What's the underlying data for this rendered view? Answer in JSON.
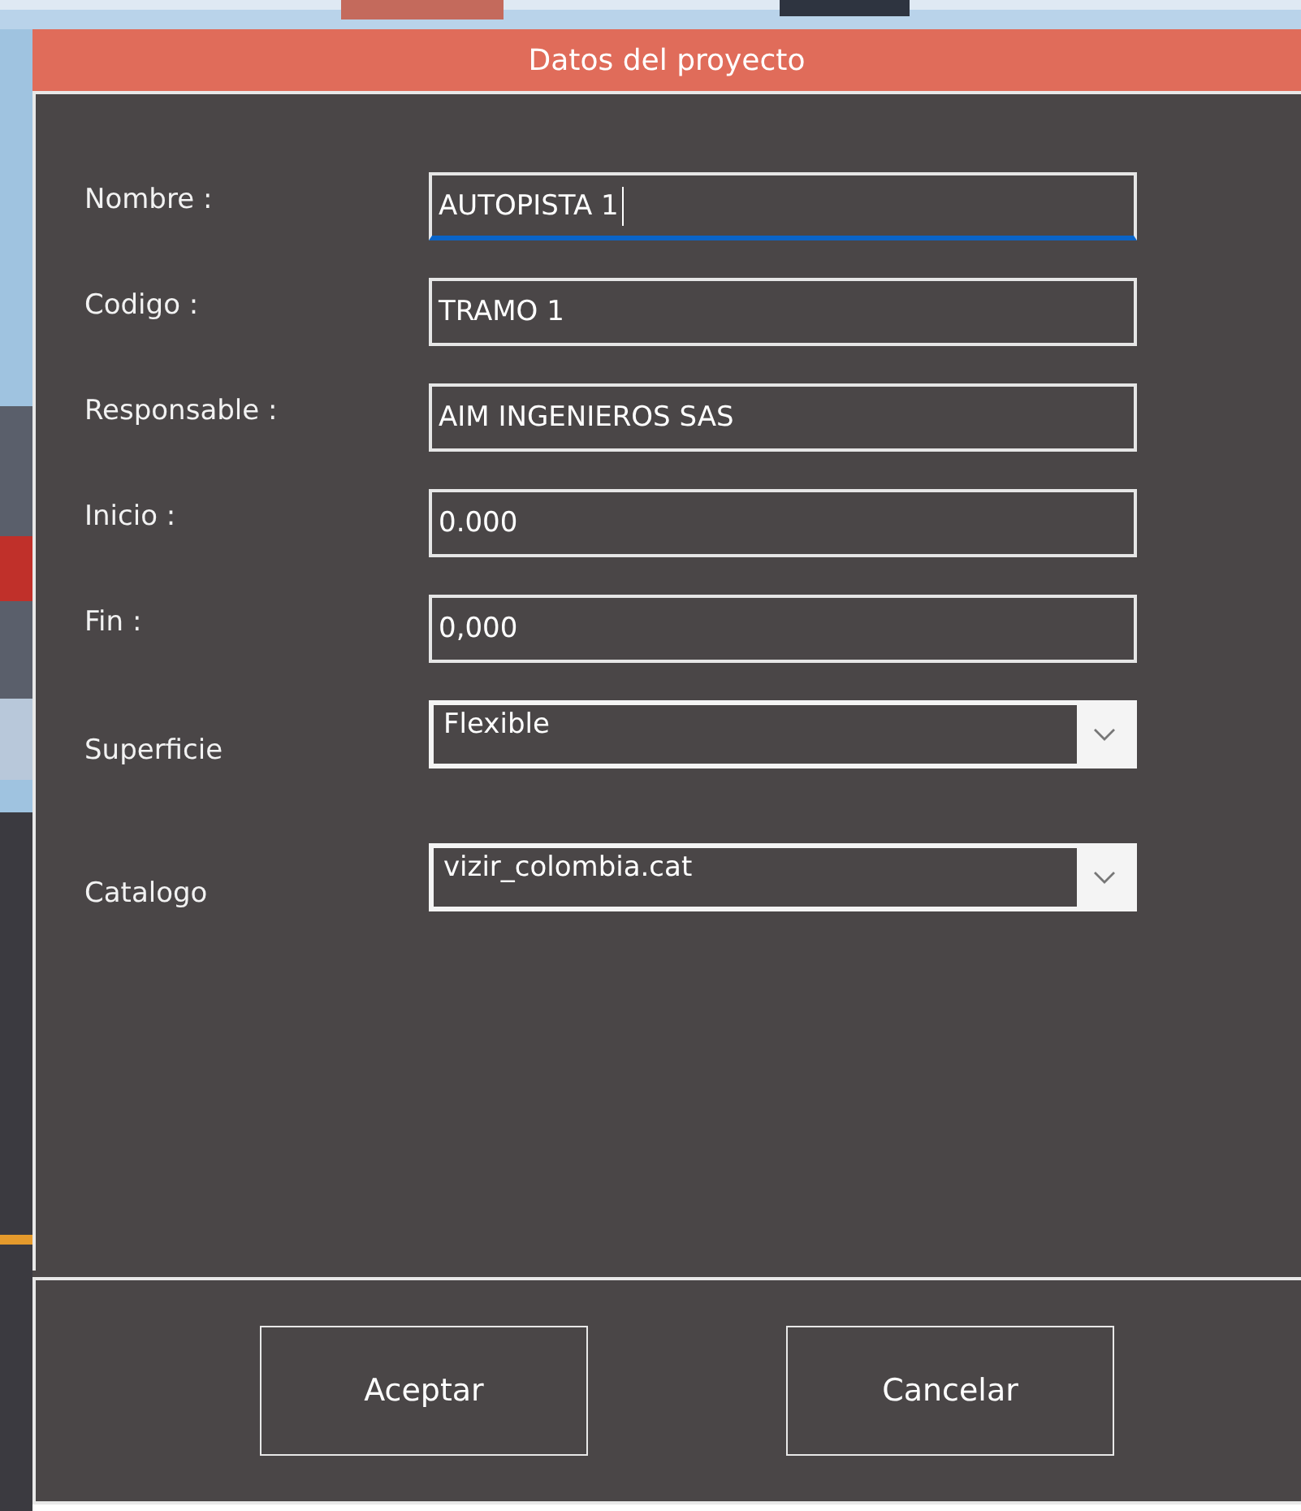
{
  "window": {
    "title": "Datos del proyecto"
  },
  "fields": [
    {
      "kind": "text",
      "label": "Nombre :",
      "value": "AUTOPISTA 1",
      "focused": true
    },
    {
      "kind": "text",
      "label": "Codigo :",
      "value": "TRAMO 1",
      "focused": false
    },
    {
      "kind": "text",
      "label": "Responsable :",
      "value": "AIM INGENIEROS SAS",
      "focused": false
    },
    {
      "kind": "text",
      "label": "Inicio :",
      "value": "0.000",
      "focused": false
    },
    {
      "kind": "text",
      "label": "Fin :",
      "value": "0,000",
      "focused": false
    },
    {
      "kind": "combo",
      "label": "Superficie",
      "value": "Flexible",
      "focused": false
    },
    {
      "kind": "combo",
      "label": "Catalogo",
      "value": "vizir_colombia.cat",
      "focused": false
    }
  ],
  "buttons": [
    "Aceptar",
    "Cancelar"
  ]
}
